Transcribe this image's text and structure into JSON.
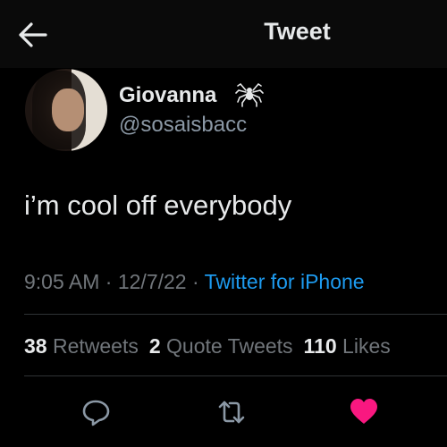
{
  "header": {
    "title": "Tweet",
    "back_icon": "arrow-left-icon"
  },
  "author": {
    "display_name": "Giovanna",
    "handle": "@sosaisbacc",
    "badge_icon": "spider-icon"
  },
  "tweet": {
    "text": "i’m cool off everybody",
    "time": "9:05 AM",
    "date": "12/7/22",
    "source": "Twitter for iPhone"
  },
  "stats": {
    "retweets_count": "38",
    "retweets_label": "Retweets",
    "quotes_count": "2",
    "quotes_label": "Quote Tweets",
    "likes_count": "110",
    "likes_label": "Likes"
  },
  "actions": {
    "reply_icon": "reply-bubble-icon",
    "retweet_icon": "retweet-icon",
    "like_icon": "heart-icon",
    "like_color": "#f91880"
  },
  "colors": {
    "background": "#000000",
    "text": "#e7e9ea",
    "muted": "#71767b",
    "link": "#1d9bf0"
  }
}
